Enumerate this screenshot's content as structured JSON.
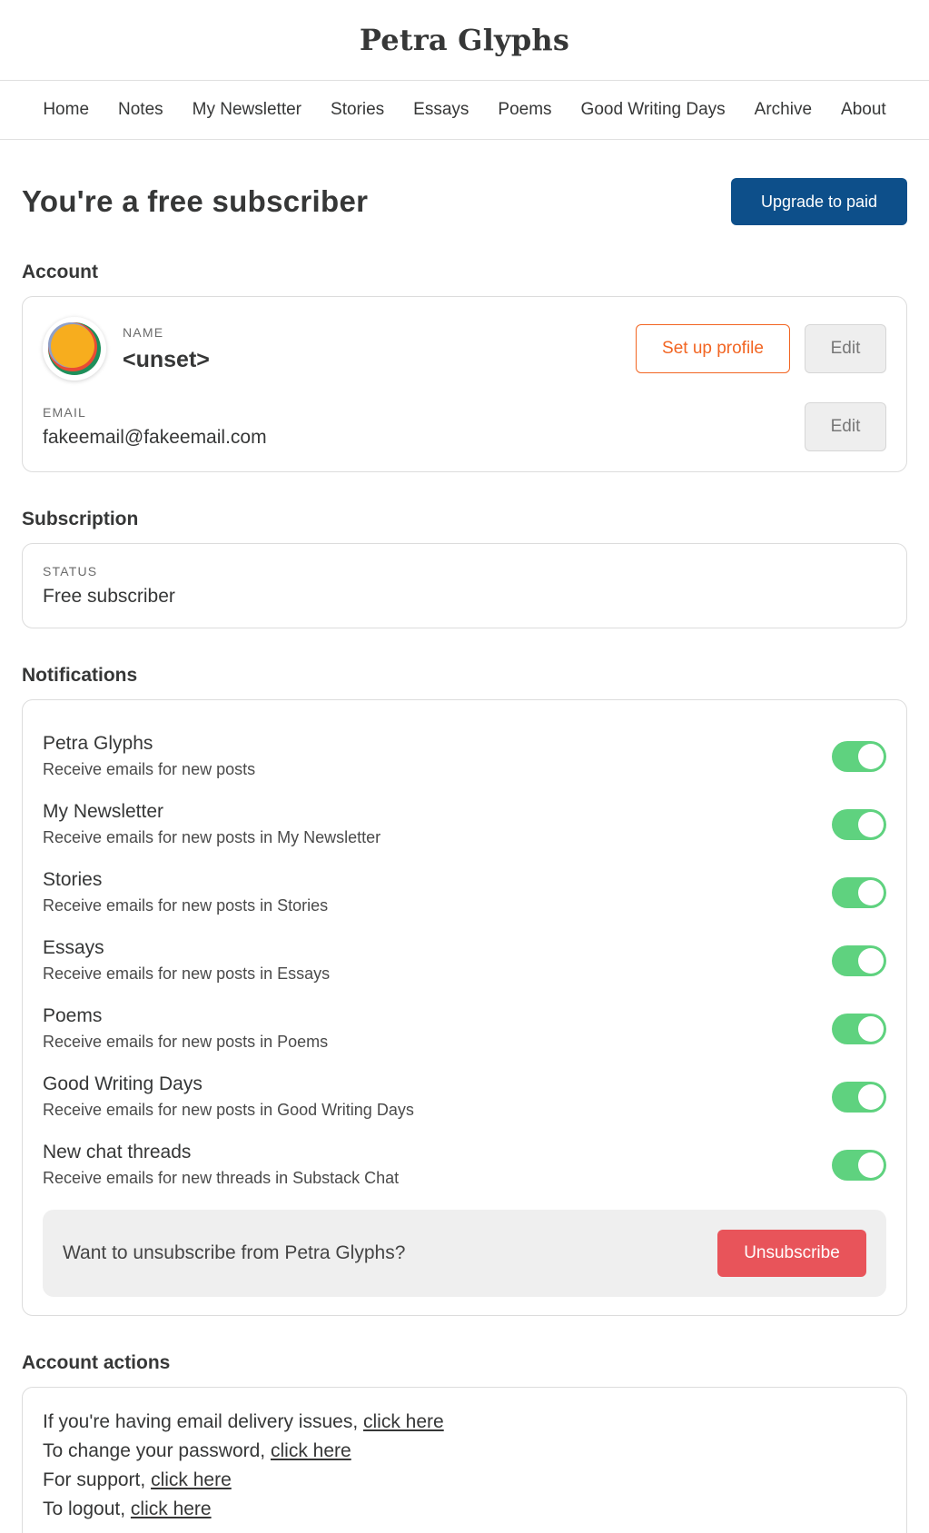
{
  "site": {
    "title": "Petra Glyphs"
  },
  "nav": [
    "Home",
    "Notes",
    "My Newsletter",
    "Stories",
    "Essays",
    "Poems",
    "Good Writing Days",
    "Archive",
    "About"
  ],
  "hero": {
    "title": "You're a free subscriber",
    "upgrade_label": "Upgrade to paid"
  },
  "account": {
    "section_label": "Account",
    "name_label": "NAME",
    "name_value": "<unset>",
    "setup_profile_label": "Set up profile",
    "edit_label": "Edit",
    "email_label": "EMAIL",
    "email_value": "fakeemail@fakeemail.com"
  },
  "subscription": {
    "section_label": "Subscription",
    "status_label": "STATUS",
    "status_value": "Free subscriber"
  },
  "notifications": {
    "section_label": "Notifications",
    "items": [
      {
        "title": "Petra Glyphs",
        "desc": "Receive emails for new posts",
        "enabled": true
      },
      {
        "title": "My Newsletter",
        "desc": "Receive emails for new posts in My Newsletter",
        "enabled": true
      },
      {
        "title": "Stories",
        "desc": "Receive emails for new posts in Stories",
        "enabled": true
      },
      {
        "title": "Essays",
        "desc": "Receive emails for new posts in Essays",
        "enabled": true
      },
      {
        "title": "Poems",
        "desc": "Receive emails for new posts in Poems",
        "enabled": true
      },
      {
        "title": "Good Writing Days",
        "desc": "Receive emails for new posts in Good Writing Days",
        "enabled": true
      },
      {
        "title": "New chat threads",
        "desc": "Receive emails for new threads in Substack Chat",
        "enabled": true
      }
    ],
    "unsubscribe_prompt": "Want to unsubscribe from Petra Glyphs?",
    "unsubscribe_label": "Unsubscribe"
  },
  "account_actions": {
    "section_label": "Account actions",
    "lines": [
      {
        "text": "If you're having email delivery issues, ",
        "link": "click here"
      },
      {
        "text": "To change your password, ",
        "link": "click here"
      },
      {
        "text": "For support, ",
        "link": "click here"
      },
      {
        "text": "To logout, ",
        "link": "click here"
      }
    ]
  },
  "colors": {
    "primary": "#0d4f8a",
    "accent_orange": "#f26522",
    "toggle_on": "#5fd27f",
    "danger": "#e8545a"
  }
}
